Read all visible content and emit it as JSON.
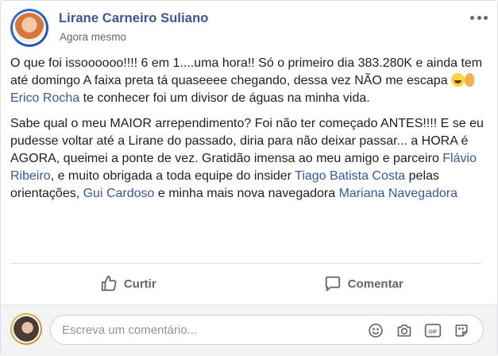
{
  "post": {
    "author": "Lirane Carneiro Suliano",
    "timestamp": "Agora mesmo",
    "paragraph1": {
      "part1": "O que foi issoooooo!!!! 6 em 1....uma hora!! Só o primeiro dia 383.280K e ainda tem até domingo A faixa preta tá quaseeee chegando, dessa vez NÃO me escapa ",
      "mention1": "Erico Rocha",
      "part2": " te conhecer foi um divisor de águas na minha vida."
    },
    "paragraph2": {
      "part1": "Sabe qual o meu MAIOR arrependimento? Foi não ter começado ANTES!!!! E se eu pudesse voltar até a Lirane do passado, diria para não deixar passar... a HORA é AGORA, queimei a ponte de vez. Gratidão imensa ao meu amigo e parceiro ",
      "mention1": "Flávio Ribeiro",
      "part2": ", e muito obrigada a toda equipe do insider ",
      "mention2": "Tiago Batista Costa",
      "part3": " pelas orientações, ",
      "mention3": "Gui Cardoso",
      "part4": " e minha mais nova navegadora ",
      "mention4": "Mariana Navegadora"
    }
  },
  "actions": {
    "like_label": "Curtir",
    "comment_label": "Comentar"
  },
  "comment_box": {
    "placeholder": "Escreva um comentário..."
  },
  "colors": {
    "link": "#385898",
    "muted": "#606770",
    "text": "#1c1e21"
  },
  "icons": [
    "more-options-icon",
    "grinning-emoji",
    "ear-emoji",
    "like-icon",
    "comment-icon",
    "emoji-icon",
    "camera-icon",
    "gif-icon",
    "sticker-icon"
  ]
}
